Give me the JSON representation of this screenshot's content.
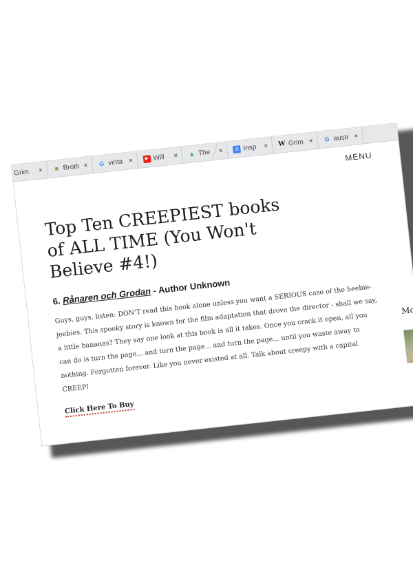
{
  "browser": {
    "tabs": [
      {
        "label": "Grim",
        "favicon": "none",
        "favicon_color": "#888888"
      },
      {
        "label": "Broth",
        "favicon": "book-icon",
        "favicon_color": "#8aa63a"
      },
      {
        "label": "vinta",
        "favicon": "google-icon",
        "favicon_color": "#4285f4"
      },
      {
        "label": "Will",
        "favicon": "youtube-icon",
        "favicon_color": "#e62117"
      },
      {
        "label": "The",
        "favicon": "drive-icon",
        "favicon_color": "#1fa463"
      },
      {
        "label": "Insp",
        "favicon": "docs-icon",
        "favicon_color": "#4285f4"
      },
      {
        "label": "Grim",
        "favicon": "wikipedia-icon",
        "favicon_color": "#222222"
      },
      {
        "label": "austr",
        "favicon": "google-icon",
        "favicon_color": "#4285f4"
      }
    ],
    "close_glyph": "×"
  },
  "header": {
    "menu_label": "MENU"
  },
  "article": {
    "title": "Top Ten CREEPIEST books of ALL TIME (You Won't Believe #4!)",
    "entry": {
      "number": "6.",
      "book_title": "Rånaren och Grodan",
      "author": "- Author Unknown",
      "body": "Guys, guys, listen: DON'T read this book alone unless you want a SERIOUS case of the heebie-jeebies. This spooky story is known for the film adaptation that drove the director - shall we say, a little bananas? They say one look at this book is all it takes. Once you crack it open, all you can do is turn the page... and turn the page... and turn the page... until you waste away to nothing. Forgotten forever. Like you never existed at all. Talk about creepy with a capital CREEP!",
      "buy_link": "Click Here To Buy"
    }
  },
  "sidebar": {
    "heading_peek": "Mo"
  }
}
